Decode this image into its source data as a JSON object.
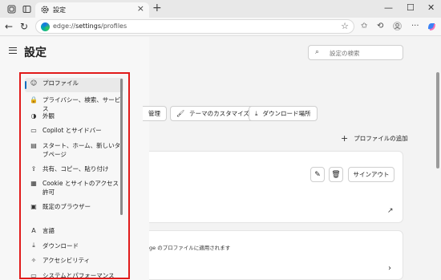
{
  "browser": {
    "tab_title": "設定",
    "url_prefix": "edge://",
    "url_host": "settings",
    "url_path": "/profiles"
  },
  "page": {
    "title": "設定",
    "search_placeholder": "設定の検索"
  },
  "sidebar": {
    "items": [
      {
        "label": "プロファイル",
        "icon": "person-circle-icon",
        "selected": true
      },
      {
        "label": "プライバシー、検索、サービス",
        "icon": "lock-icon"
      },
      {
        "label": "外観",
        "icon": "appearance-icon"
      },
      {
        "label": "Copilot とサイドバー",
        "icon": "sidebar-icon"
      },
      {
        "label": "スタート、ホーム、新しいタブページ",
        "icon": "home-tab-icon"
      },
      {
        "label": "共有、コピー、貼り付け",
        "icon": "share-icon"
      },
      {
        "label": "Cookie とサイトのアクセス許可",
        "icon": "cookie-icon"
      },
      {
        "label": "既定のブラウザー",
        "icon": "browser-icon"
      },
      {
        "label": "言語",
        "icon": "language-icon"
      },
      {
        "label": "ダウンロード",
        "icon": "download-icon"
      },
      {
        "label": "アクセシビリティ",
        "icon": "accessibility-icon"
      },
      {
        "label": "システムとパフォーマンス",
        "icon": "system-icon"
      }
    ]
  },
  "main": {
    "buttons": {
      "manage": "管理",
      "theme": "テーマのカスタマイズ",
      "download_location": "ダウンロード場所"
    },
    "add_profile": "プロファイルの追加",
    "sign_out": "サインアウト",
    "applies_text": "ge のプロファイルに適用されます"
  },
  "colors": {
    "accent": "#0f6cbd",
    "highlight_frame": "#e11b1b"
  }
}
